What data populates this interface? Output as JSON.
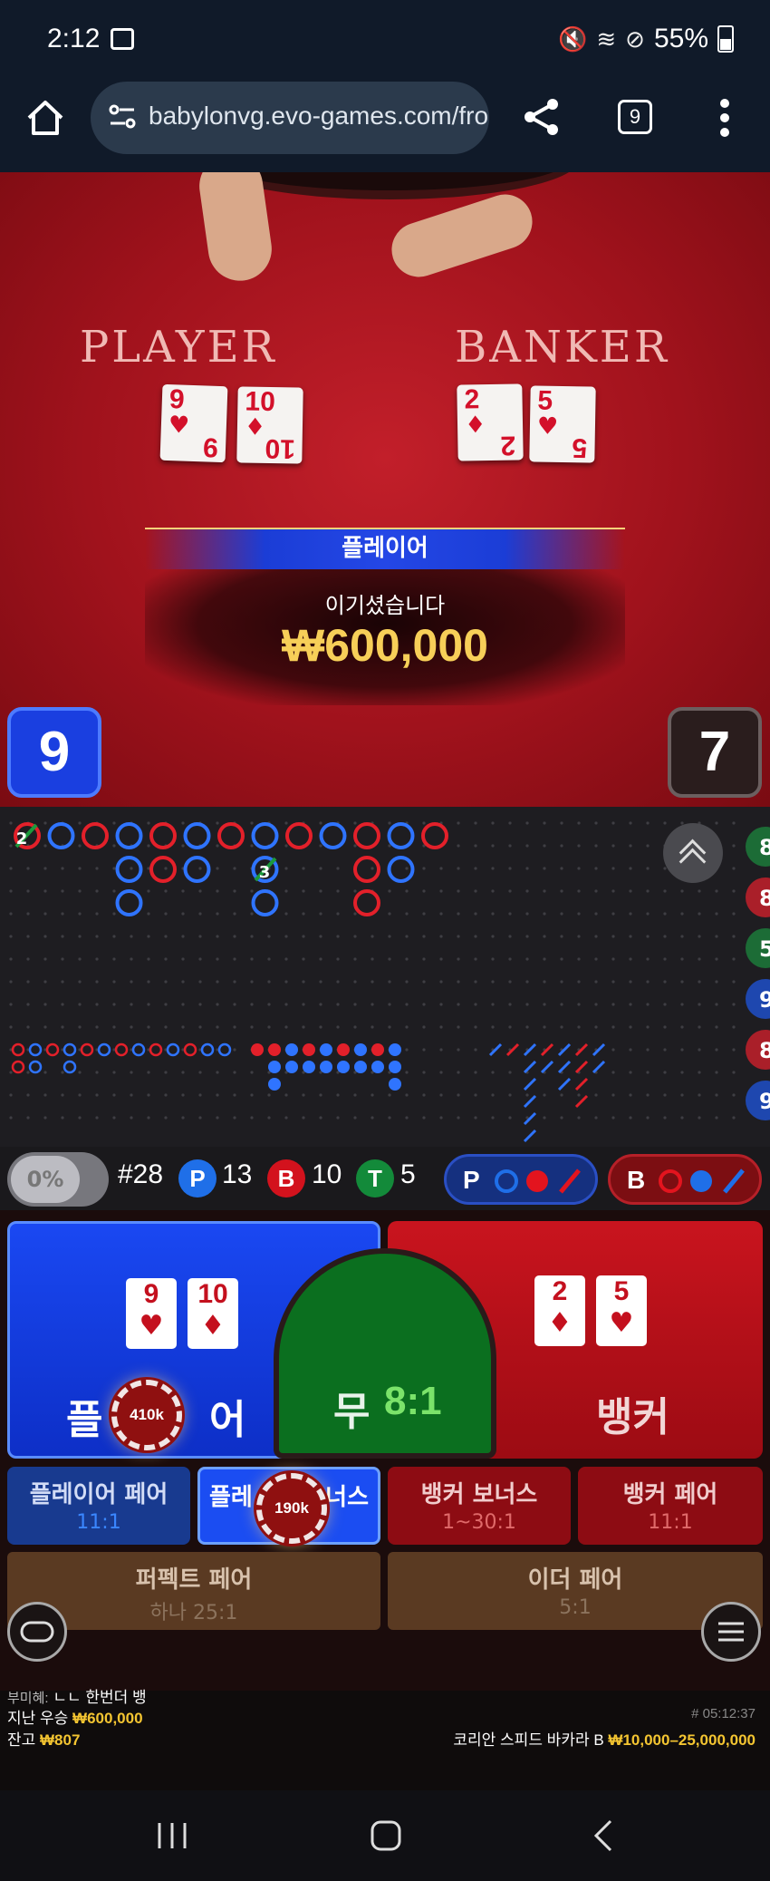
{
  "status_bar": {
    "time": "2:12",
    "battery": "55%"
  },
  "browser": {
    "url": "babylonvg.evo-games.com/fro",
    "tab_count": "9"
  },
  "table": {
    "player_label": "PLAYER",
    "banker_label": "BANKER",
    "player_cards": [
      {
        "rank": "9",
        "suit": "♥"
      },
      {
        "rank": "10",
        "suit": "♦"
      }
    ],
    "banker_cards": [
      {
        "rank": "2",
        "suit": "♦"
      },
      {
        "rank": "5",
        "suit": "♥"
      }
    ],
    "result_banner": "플레이어",
    "win_text": "이기셨습니다",
    "win_amount": "₩600,000",
    "player_score": "9",
    "banker_score": "7"
  },
  "roadmap": {
    "big_road_labels": [
      "2",
      "3"
    ],
    "side_labels": [
      "8",
      "8",
      "5",
      "9",
      "8",
      "9"
    ]
  },
  "stats": {
    "percent": "0%",
    "round": "#28",
    "player_letter": "P",
    "player_count": "13",
    "banker_letter": "B",
    "banker_count": "10",
    "tie_letter": "T",
    "tie_count": "5",
    "player_predict_letter": "P",
    "banker_predict_letter": "B"
  },
  "bets": {
    "player_label": "플레이어",
    "player_label_left": "플",
    "player_label_right": "어",
    "player_chip": "410k",
    "player_cards": [
      {
        "rank": "9",
        "suit": "♥"
      },
      {
        "rank": "10",
        "suit": "♦"
      }
    ],
    "tie_label": "무",
    "tie_odds": "8:1",
    "banker_label": "뱅커",
    "banker_cards": [
      {
        "rank": "2",
        "suit": "♦"
      },
      {
        "rank": "5",
        "suit": "♥"
      }
    ],
    "player_pair": {
      "label": "플레이어 페어",
      "odds": "11:1"
    },
    "player_bonus": {
      "label_left": "플레",
      "label_right": "너스",
      "chip": "190k"
    },
    "banker_bonus": {
      "label": "뱅커 보너스",
      "odds": "1~30:1"
    },
    "banker_pair": {
      "label": "뱅커 페어",
      "odds": "11:1"
    },
    "perfect_pair": {
      "label": "퍼펙트 페어",
      "odds": "하나 25:1"
    },
    "either_pair": {
      "label": "이더 페어",
      "odds": "5:1"
    }
  },
  "footer": {
    "chat_user": "부미혜:",
    "chat_message": "ㄴㄴ 한번더 뱅",
    "last_win_label": "지난 우승",
    "last_win_value": "₩600,000",
    "balance_label": "잔고",
    "balance_value": "₩807",
    "game_id": "# 05:12:37",
    "table_name": "코리안 스피드 바카라 B",
    "limits": "₩10,000–25,000,000"
  },
  "colors": {
    "player_blue": "#1a48f2",
    "banker_red": "#c9141e",
    "tie_green": "#0b6f1f",
    "gold": "#f4c531"
  }
}
